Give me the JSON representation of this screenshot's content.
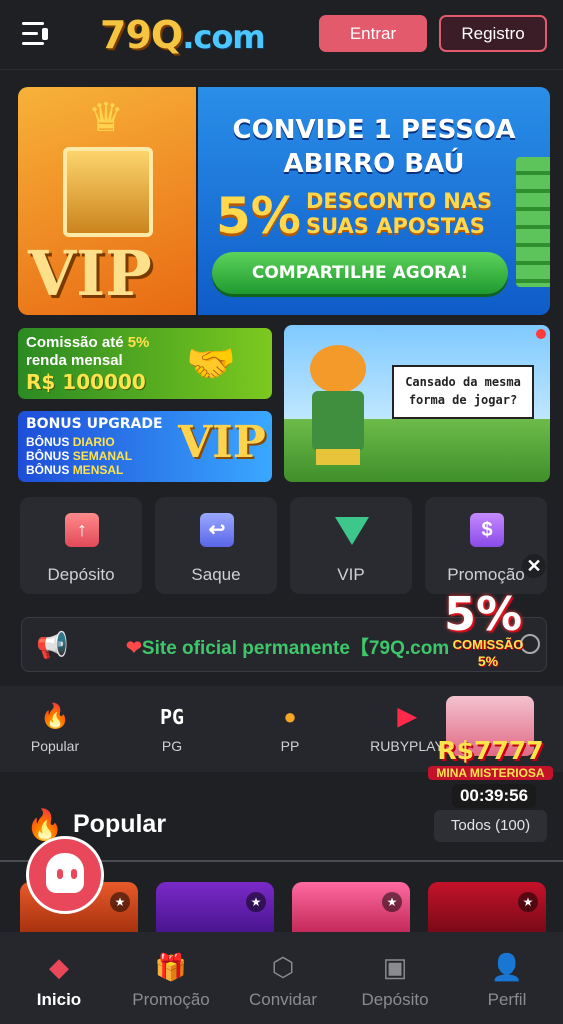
{
  "header": {
    "logo_number": "79Q",
    "logo_domain": ".com",
    "login_label": "Entrar",
    "register_label": "Registro"
  },
  "banner": {
    "vip_text": "VIP",
    "line1": "CONVIDE 1 PESSOA",
    "line2": "ABIRRO BAÚ",
    "percent": "5%",
    "line3": "DESCONTO NAS SUAS APOSTAS",
    "cta": "COMPARTILHE AGORA!"
  },
  "promo_commission": {
    "line1_prefix": "Comissão até",
    "line1_value": "5%",
    "line2": "renda mensal",
    "amount": "R$ 100000"
  },
  "promo_bonus": {
    "title": "BONUS UPGRADE",
    "lines": [
      {
        "prefix": "BÔNUS",
        "value": "DIARIO"
      },
      {
        "prefix": "BÔNUS",
        "value": "SEMANAL"
      },
      {
        "prefix": "BÔNUS",
        "value": "MENSAL"
      }
    ],
    "vip": "VIP"
  },
  "promo_tiger": {
    "speech": "Cansado da mesma forma de jogar?"
  },
  "quick_actions": [
    {
      "label": "Depósito",
      "icon": "upload-icon"
    },
    {
      "label": "Saque",
      "icon": "return-arrow-icon"
    },
    {
      "label": "VIP",
      "icon": "diamond-icon"
    },
    {
      "label": "Promoção",
      "icon": "dollar-tag-icon"
    }
  ],
  "ticker": {
    "text": "Site oficial permanente【79Q.com"
  },
  "float_commission": {
    "big": "5%",
    "label": "COMISSÃO",
    "percent": "5%"
  },
  "float_gift": {
    "amount": "R$7777",
    "label": "MINA MISTERIOSA",
    "timer": "00:39:56"
  },
  "categories": [
    {
      "label": "Popular",
      "icon": "flame-icon"
    },
    {
      "label": "PG",
      "icon": "pg-logo-icon"
    },
    {
      "label": "PP",
      "icon": "pp-logo-icon"
    },
    {
      "label": "RUBYPLAY",
      "icon": "ruby-play-icon"
    }
  ],
  "popular": {
    "title": "Popular",
    "all_label": "Todos (100)"
  },
  "bottom_nav": [
    {
      "label": "Inicio",
      "icon": "home-icon"
    },
    {
      "label": "Promoção",
      "icon": "gift-icon"
    },
    {
      "label": "Convidar",
      "icon": "share-icon"
    },
    {
      "label": "Depósito",
      "icon": "wallet-icon"
    },
    {
      "label": "Perfil",
      "icon": "user-icon"
    }
  ],
  "colors": {
    "accent": "#e25a6c",
    "background": "#1f2024",
    "ticker_text": "#3ec76a"
  }
}
